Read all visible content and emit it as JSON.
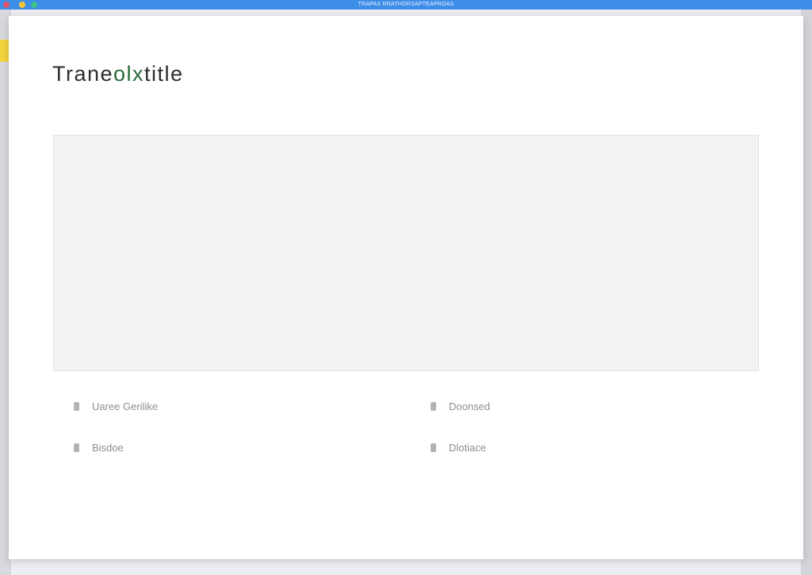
{
  "topbar": {
    "title": "TRAPAX RNATHORSAPTEAPROAS"
  },
  "dialog": {
    "title_start": "Trane",
    "title_mid": "olx",
    "title_end": "title"
  },
  "options": [
    {
      "label": "Uaree Gerilike"
    },
    {
      "label": "Doonsed"
    },
    {
      "label": "Bisdoe"
    },
    {
      "label": "Dlotiace"
    }
  ],
  "colors": {
    "topbar": "#3d8ee8",
    "panel": "#f3f3f3",
    "option_text": "#8e8e8e"
  }
}
